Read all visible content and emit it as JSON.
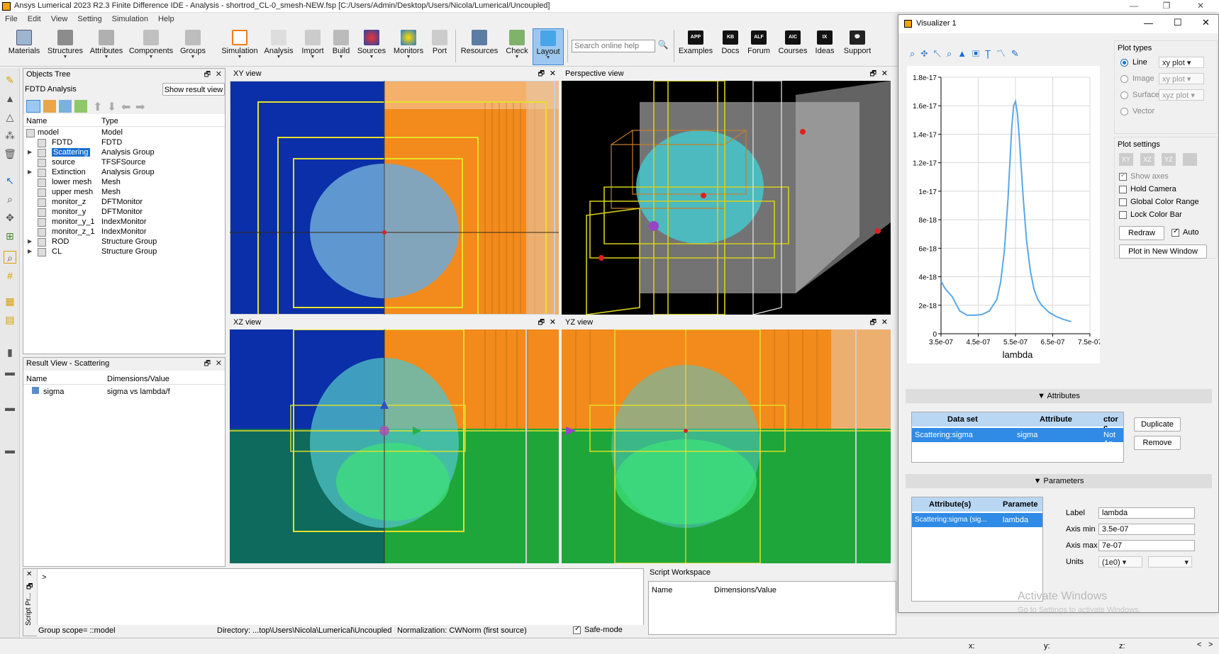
{
  "window": {
    "title": "Ansys Lumerical 2023 R2.3 Finite Difference IDE - Analysis - shortrod_CL-0_smesh-NEW.fsp [C:/Users/Admin/Desktop/Users/Nicola/Lumerical/Uncoupled]"
  },
  "menu": [
    "File",
    "Edit",
    "View",
    "Setting",
    "Simulation",
    "Help"
  ],
  "toolbar": {
    "items": [
      "Materials",
      "Structures",
      "Attributes",
      "Components",
      "Groups",
      "Simulation",
      "Analysis",
      "Import",
      "Build",
      "Sources",
      "Monitors",
      "Port",
      "Resources",
      "Check",
      "Layout"
    ],
    "search_placeholder": "Search online help",
    "help_items": [
      {
        "badge": "APP",
        "label": "Examples"
      },
      {
        "badge": "KB",
        "label": "Docs"
      },
      {
        "badge": "ALF",
        "label": "Forum"
      },
      {
        "badge": "AIC",
        "label": "Courses"
      },
      {
        "badge": "IX",
        "label": "Ideas"
      },
      {
        "badge": "",
        "label": "Support"
      }
    ]
  },
  "objects_tree": {
    "title": "Objects Tree",
    "analysis_label": "FDTD Analysis",
    "show_result_btn": "Show result view",
    "columns": [
      "Name",
      "Type"
    ],
    "rows": [
      {
        "name": "model",
        "type": "Model"
      },
      {
        "name": "FDTD",
        "type": "FDTD"
      },
      {
        "name": "Scattering",
        "type": "Analysis Group"
      },
      {
        "name": "source",
        "type": "TFSFSource"
      },
      {
        "name": "Extinction",
        "type": "Analysis Group"
      },
      {
        "name": "lower mesh",
        "type": "Mesh"
      },
      {
        "name": "upper mesh",
        "type": "Mesh"
      },
      {
        "name": "monitor_z",
        "type": "DFTMonitor"
      },
      {
        "name": "monitor_y",
        "type": "DFTMonitor"
      },
      {
        "name": "monitor_y_1",
        "type": "IndexMonitor"
      },
      {
        "name": "monitor_z_1",
        "type": "IndexMonitor"
      },
      {
        "name": "ROD",
        "type": "Structure Group"
      },
      {
        "name": "CL",
        "type": "Structure Group"
      }
    ]
  },
  "result_view": {
    "title": "Result View - Scattering",
    "columns": [
      "Name",
      "Dimensions/Value"
    ],
    "rows": [
      {
        "name": "sigma",
        "value": "sigma vs lambda/f"
      }
    ]
  },
  "views": {
    "xy": "XY view",
    "persp": "Perspective view",
    "xz": "XZ view",
    "yz": "YZ view"
  },
  "script": {
    "prompt": ">",
    "side_label": "Script Pr...",
    "workspace_title": "Script Workspace",
    "workspace_cols": [
      "Name",
      "Dimensions/Value"
    ],
    "group_scope": "Group scope= ::model",
    "directory": "Directory: ...top\\Users\\Nicola\\Lumerical\\Uncoupled",
    "normalization": "Normalization: CWNorm (first source)",
    "safe_mode": "Safe-mode"
  },
  "visualizer": {
    "title": "Visualizer 1",
    "plot_types_title": "Plot types",
    "plot_types": [
      {
        "label": "Line",
        "option": "xy plot",
        "selected": true
      },
      {
        "label": "Image",
        "option": "xy plot",
        "selected": false
      },
      {
        "label": "Surface",
        "option": "xyz plot",
        "selected": false
      },
      {
        "label": "Vector",
        "option": "",
        "selected": false
      }
    ],
    "plot_settings_title": "Plot settings",
    "axis_buttons": [
      "XY",
      "XZ",
      "YZ"
    ],
    "settings": [
      {
        "label": "Show axes",
        "checked": true
      },
      {
        "label": "Hold Camera",
        "checked": false
      },
      {
        "label": "Global Color Range",
        "checked": false
      },
      {
        "label": "Lock Color Bar",
        "checked": false
      }
    ],
    "redraw": "Redraw",
    "auto": "Auto",
    "plot_new_window": "Plot in New Window",
    "attributes_title": "Attributes",
    "attr_cols": [
      "Data set",
      "Attribute",
      "ctor c"
    ],
    "attr_row": [
      "Scattering:sigma",
      "sigma",
      "Not Ap"
    ],
    "duplicate": "Duplicate",
    "remove": "Remove",
    "parameters_title": "Parameters",
    "param_cols": [
      "Attribute(s)",
      "Paramete"
    ],
    "param_row": [
      "Scattering:sigma (sig...",
      "lambda"
    ],
    "label_lbl": "Label",
    "label_val": "lambda",
    "axis_min_lbl": "Axis min",
    "axis_min_val": "3.5e-07",
    "axis_max_lbl": "Axis max",
    "axis_max_val": "7e-07",
    "units_lbl": "Units",
    "units_val": "(1e0)",
    "watermark1": "Activate Windows",
    "watermark2": "Go to Settings to activate Windows."
  },
  "status": {
    "x": "x:",
    "y": "y:",
    "z": "z:"
  },
  "chart_data": {
    "type": "line",
    "xlabel": "lambda",
    "ylabel": "",
    "xlim": [
      3.5e-07,
      7.5e-07
    ],
    "ylim": [
      0,
      1.8e-17
    ],
    "xticks": [
      "3.5e-07",
      "4.5e-07",
      "5.5e-07",
      "6.5e-07",
      "7.5e-07"
    ],
    "yticks": [
      "0",
      "2e-18",
      "4e-18",
      "6e-18",
      "8e-18",
      "1e-17",
      "1.2e-17",
      "1.4e-17",
      "1.6e-17",
      "1.8e-17"
    ],
    "color": "#5aa7e6",
    "series": [
      {
        "x": [
          3.5e-07,
          3.6e-07,
          3.7e-07,
          3.8e-07,
          3.9e-07,
          4e-07,
          4.2e-07,
          4.4e-07,
          4.6e-07,
          4.8e-07,
          5e-07,
          5.1e-07,
          5.2e-07,
          5.3e-07,
          5.35e-07,
          5.4e-07,
          5.45e-07,
          5.5e-07,
          5.55e-07,
          5.6e-07,
          5.65e-07,
          5.7e-07,
          5.8e-07,
          5.9e-07,
          6e-07,
          6.1e-07,
          6.2e-07,
          6.4e-07,
          6.6e-07,
          6.8e-07,
          7e-07
        ],
        "y": [
          3.7e-18,
          3.2e-18,
          2.9e-18,
          2.6e-18,
          2.1e-18,
          1.6e-18,
          1.3e-18,
          1.3e-18,
          1.35e-18,
          1.6e-18,
          2.4e-18,
          3.6e-18,
          5.8e-18,
          9.5e-18,
          1.2e-17,
          1.45e-17,
          1.6e-17,
          1.63e-17,
          1.55e-17,
          1.38e-17,
          1.18e-17,
          9.8e-18,
          6.5e-18,
          4.4e-18,
          3.1e-18,
          2.4e-18,
          2e-18,
          1.5e-18,
          1.2e-18,
          1e-18,
          8.5e-19
        ]
      }
    ]
  }
}
